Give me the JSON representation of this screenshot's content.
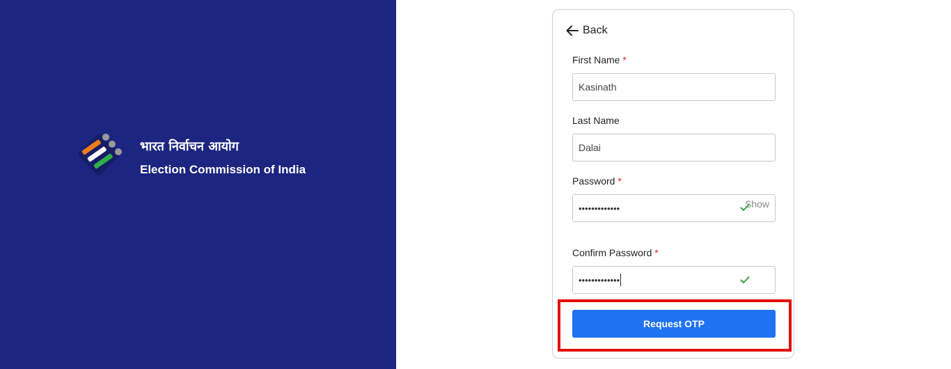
{
  "branding": {
    "hindi_title": "भारत निर्वाचन आयोग",
    "english_title": "Election Commission of India",
    "logo_icon": "ballot-logo-icon",
    "panel_color": "#1c2580"
  },
  "form": {
    "back_label": "Back",
    "first_name": {
      "label": "First Name",
      "required_mark": "*",
      "value": "Kasinath"
    },
    "last_name": {
      "label": "Last Name",
      "value": "Dalai"
    },
    "password": {
      "label": "Password",
      "required_mark": "*",
      "value": "•••••••••••••",
      "show_label": "Show",
      "valid": true
    },
    "confirm_password": {
      "label": "Confirm Password",
      "required_mark": "*",
      "value": "•••••••••••••",
      "valid": true
    },
    "submit_label": "Request OTP",
    "accent_color": "#1f72f2",
    "highlight_color": "#e30f0f"
  }
}
